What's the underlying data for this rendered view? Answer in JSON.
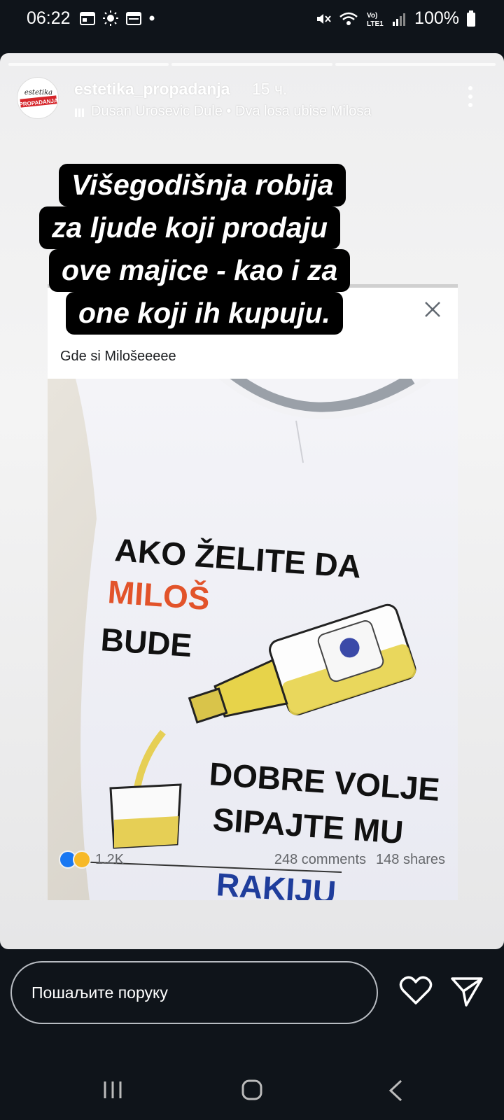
{
  "status_bar": {
    "time": "06:22",
    "network": "Vo) LTE1",
    "battery": "100%"
  },
  "story": {
    "progress_segments": 3,
    "username": "estetika_propadanja",
    "time_ago": "15 ч.",
    "music": "Dusan Urosevic Dule • Dva losa ubise Milosa",
    "avatar_text": [
      "estetika",
      "PROPADANJA"
    ],
    "overlay_lines": [
      "Višegodišnja robija",
      "za ljude koji prodaju",
      "ove majice - kao i za",
      "one koji ih kupuju."
    ]
  },
  "post": {
    "caption": "Gde si Milošeeeee",
    "reactions_count": "1.2K",
    "comments": "248 comments",
    "shares": "148 shares",
    "shirt_text": {
      "line1": "AKO ŽELITE DA",
      "line2": "MILOŠ",
      "line3": "BUDE",
      "line4": "DOBRE VOLJE",
      "line5": "SIPAJTE MU",
      "line6": "RAKIJU"
    }
  },
  "bottom": {
    "message_placeholder": "Пошаљите поруку"
  },
  "colors": {
    "background": "#0f141a",
    "overlay_bg": "#000000",
    "like_blue": "#1877f2",
    "haha_yellow": "#f7b928",
    "shirt_accent": "#e2532a"
  }
}
